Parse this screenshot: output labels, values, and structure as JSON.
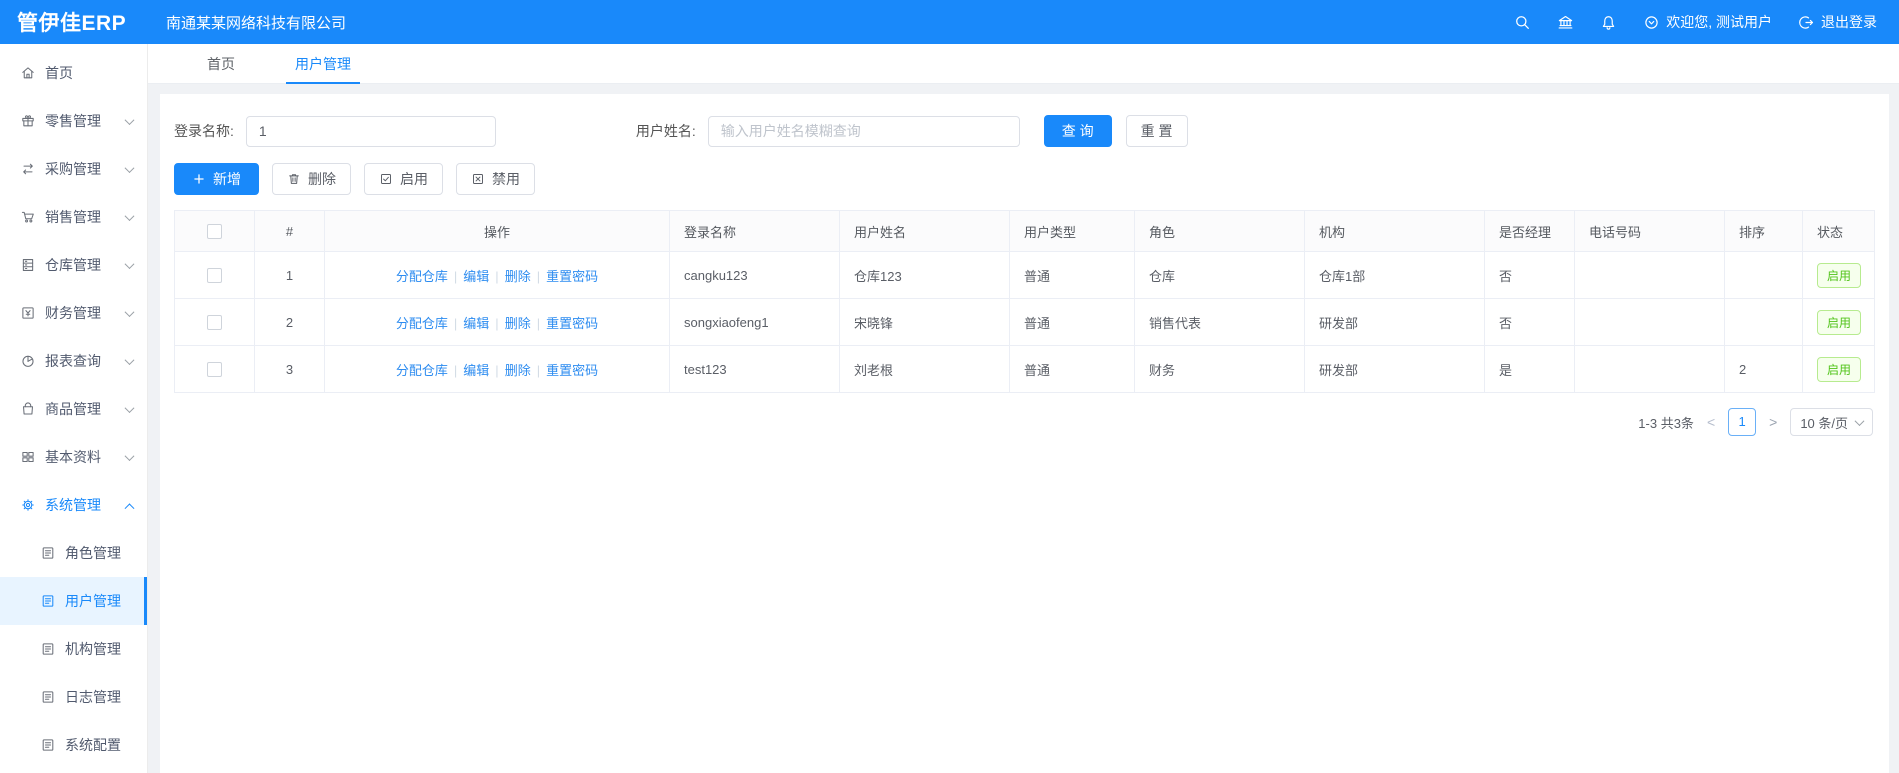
{
  "colors": {
    "primary": "#1989fa",
    "success_green": "#52c41a",
    "link_blue": "#2d8cf0"
  },
  "topbar": {
    "logo": "管伊佳ERP",
    "company": "南通某某网络科技有限公司",
    "icons": [
      "search-icon",
      "bank-icon",
      "bell-icon"
    ],
    "welcome": "欢迎您, 测试用户",
    "welcome_icon": "user-circle-icon",
    "logout": "退出登录",
    "logout_icon": "logout-icon"
  },
  "tabs": [
    {
      "label": "首页",
      "active": false
    },
    {
      "label": "用户管理",
      "active": true
    }
  ],
  "sidebar": {
    "items": [
      {
        "key": "home",
        "label": "首页",
        "icon": "home-icon",
        "chevron": null,
        "active": false
      },
      {
        "key": "retail",
        "label": "零售管理",
        "icon": "gift-icon",
        "chevron": "down",
        "active": false
      },
      {
        "key": "purchase",
        "label": "采购管理",
        "icon": "sync-icon",
        "chevron": "down",
        "active": false
      },
      {
        "key": "sales",
        "label": "销售管理",
        "icon": "cart-icon",
        "chevron": "down",
        "active": false
      },
      {
        "key": "warehouse",
        "label": "仓库管理",
        "icon": "warehouse-icon",
        "chevron": "down",
        "active": false
      },
      {
        "key": "finance",
        "label": "财务管理",
        "icon": "finance-icon",
        "chevron": "down",
        "active": false
      },
      {
        "key": "reports",
        "label": "报表查询",
        "icon": "report-icon",
        "chevron": "down",
        "active": false
      },
      {
        "key": "goods",
        "label": "商品管理",
        "icon": "goods-icon",
        "chevron": "down",
        "active": false
      },
      {
        "key": "basic-data",
        "label": "基本资料",
        "icon": "grid-icon",
        "chevron": "down",
        "active": false
      },
      {
        "key": "system",
        "label": "系统管理",
        "icon": "gear-icon",
        "chevron": "up",
        "active": true,
        "children": [
          {
            "key": "role-mgmt",
            "label": "角色管理",
            "icon": "form-icon",
            "active": false
          },
          {
            "key": "user-mgmt",
            "label": "用户管理",
            "icon": "form-icon",
            "active": true
          },
          {
            "key": "org-mgmt",
            "label": "机构管理",
            "icon": "form-icon",
            "active": false
          },
          {
            "key": "log-mgmt",
            "label": "日志管理",
            "icon": "form-icon",
            "active": false
          },
          {
            "key": "system-config",
            "label": "系统配置",
            "icon": "form-icon",
            "active": false
          }
        ]
      }
    ]
  },
  "filters": {
    "login_name_label": "登录名称:",
    "login_name_value": "1",
    "user_name_label": "用户姓名:",
    "user_name_placeholder": "输入用户姓名模糊查询",
    "search_label": "查 询",
    "reset_label": "重 置"
  },
  "toolbar": {
    "add_label": "新增",
    "add_icon": "plus-icon",
    "delete_label": "删除",
    "delete_icon": "trash-icon",
    "enable_label": "启用",
    "enable_icon": "check-square-icon",
    "disable_label": "禁用",
    "disable_icon": "x-square-icon"
  },
  "table": {
    "headers": [
      "#",
      "操作",
      "登录名称",
      "用户姓名",
      "用户类型",
      "角色",
      "机构",
      "是否经理",
      "电话号码",
      "排序",
      "状态"
    ],
    "action_links": [
      "分配仓库",
      "编辑",
      "删除",
      "重置密码"
    ],
    "rows": [
      {
        "index": "1",
        "login": "cangku123",
        "name": "仓库123",
        "type": "普通",
        "role": "仓库",
        "org": "仓库1部",
        "manager": "否",
        "phone": "",
        "sort": "",
        "status": "启用"
      },
      {
        "index": "2",
        "login": "songxiaofeng1",
        "name": "宋晓锋",
        "type": "普通",
        "role": "销售代表",
        "org": "研发部",
        "manager": "否",
        "phone": "",
        "sort": "",
        "status": "启用"
      },
      {
        "index": "3",
        "login": "test123",
        "name": "刘老根",
        "type": "普通",
        "role": "财务",
        "org": "研发部",
        "manager": "是",
        "phone": "",
        "sort": "2",
        "status": "启用"
      }
    ]
  },
  "pagination": {
    "summary": "1-3 共3条",
    "prev": "<",
    "current_page": "1",
    "next": ">",
    "page_size": "10 条/页"
  }
}
